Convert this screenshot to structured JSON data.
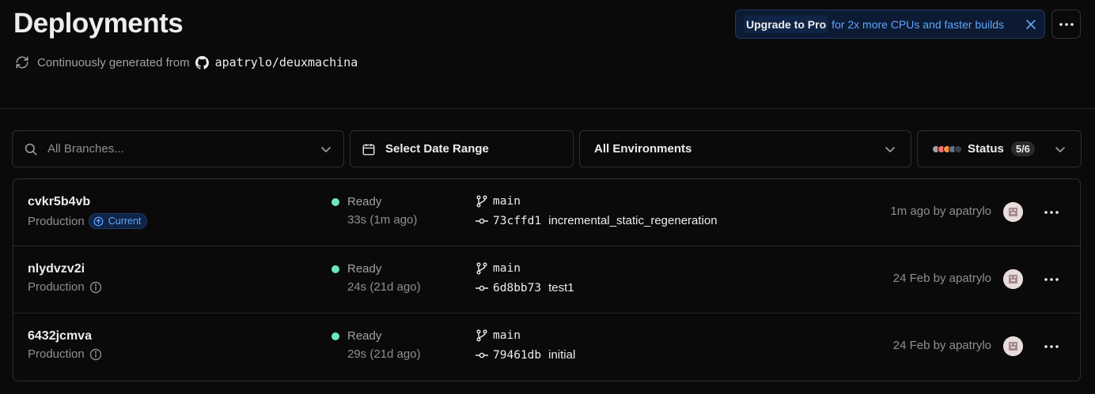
{
  "header": {
    "title": "Deployments",
    "generated_prefix": "Continuously generated from",
    "repo": "apatrylo/deuxmachina"
  },
  "banner": {
    "upgrade_label": "Upgrade to Pro",
    "promo_text": "for 2x more CPUs and faster builds"
  },
  "filters": {
    "branch_placeholder": "All Branches...",
    "date_label": "Select Date Range",
    "environment_label": "All Environments",
    "status_label": "Status",
    "status_count": "5/6",
    "status_dot_colors": [
      "#a1a1a1",
      "#f87171",
      "#fb923c",
      "#6b7280",
      "#374151"
    ]
  },
  "deployments": [
    {
      "id": "cvkr5b4vb",
      "environment": "Production",
      "badge": "Current",
      "status": "Ready",
      "duration": "33s (1m ago)",
      "branch": "main",
      "sha": "73cffd1",
      "message": "incremental_static_regeneration",
      "when": "1m ago by apatrylo"
    },
    {
      "id": "nlydvzv2i",
      "environment": "Production",
      "badge": "",
      "status": "Ready",
      "duration": "24s (21d ago)",
      "branch": "main",
      "sha": "6d8bb73",
      "message": "test1",
      "when": "24 Feb by apatrylo"
    },
    {
      "id": "6432jcmva",
      "environment": "Production",
      "badge": "",
      "status": "Ready",
      "duration": "29s (21d ago)",
      "branch": "main",
      "sha": "79461db",
      "message": "initial",
      "when": "24 Feb by apatrylo"
    }
  ],
  "colors": {
    "ready": "#6ee7b7",
    "accent": "#60a5fa"
  }
}
